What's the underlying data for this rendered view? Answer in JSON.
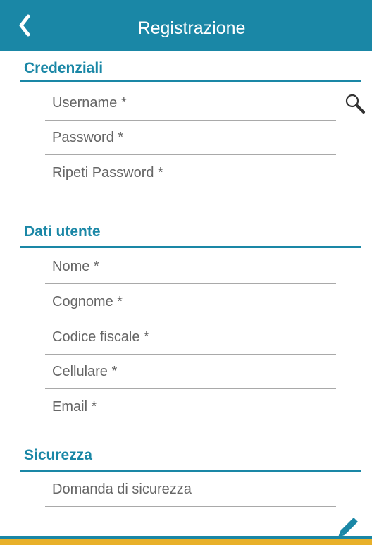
{
  "header": {
    "title": "Registrazione",
    "back_icon": "chevron-left-icon",
    "background": "#1a87a6"
  },
  "sections": {
    "credentials": {
      "title": "Credenziali",
      "fields": {
        "username": "Username *",
        "password": "Password *",
        "repeat_password": "Ripeti Password *"
      },
      "search_icon": "search-icon"
    },
    "user_data": {
      "title": "Dati utente",
      "fields": {
        "nome": "Nome *",
        "cognome": "Cognome *",
        "codice_fiscale": "Codice fiscale *",
        "cellulare": "Cellulare *",
        "email": "Email *"
      }
    },
    "security": {
      "title": "Sicurezza",
      "fields": {
        "domanda": "Domanda di sicurezza"
      }
    }
  },
  "footer": {
    "edit_icon": "pencil-icon",
    "accent": "#e8b02a"
  }
}
